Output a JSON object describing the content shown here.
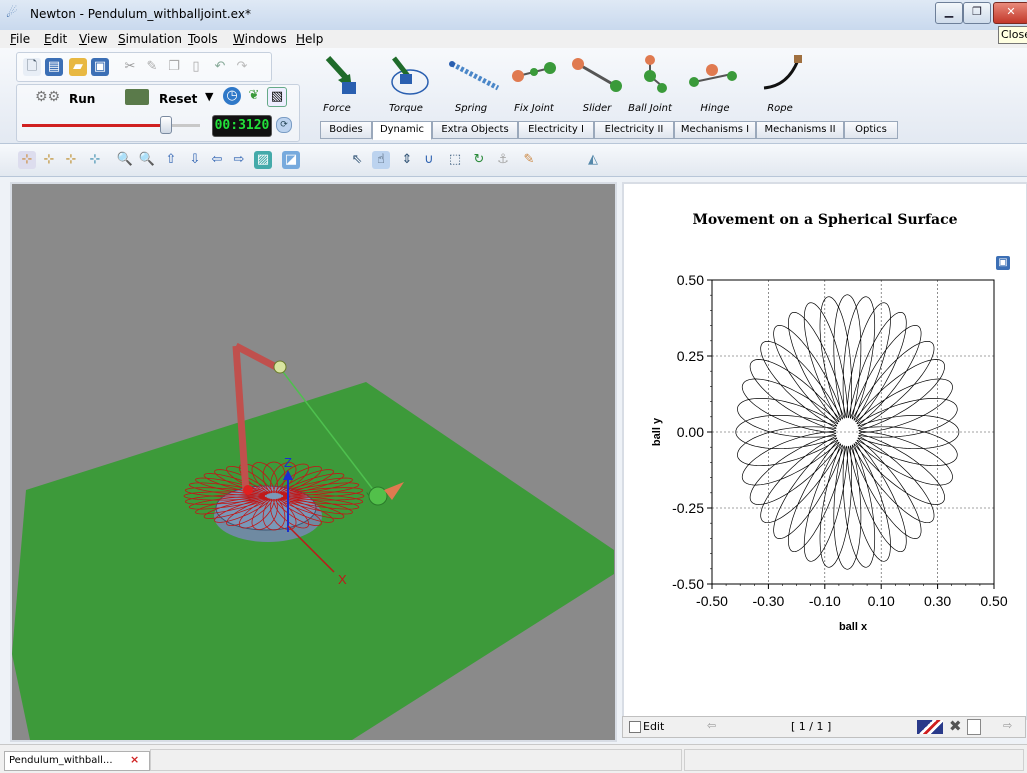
{
  "window": {
    "title": "Newton - Pendulum_withballjoint.ex*",
    "tooltip": "Close",
    "min_glyph": "▁",
    "max_glyph": "❐",
    "close_glyph": "✕"
  },
  "menu": [
    "File",
    "Edit",
    "View",
    "Simulation",
    "Tools",
    "Windows",
    "Help"
  ],
  "sim_controls": {
    "run_label": "Run",
    "reset_label": "Reset",
    "timer": "00:3120",
    "progress": 0.78
  },
  "palette": {
    "items": [
      "Force",
      "Torque",
      "Spring",
      "Fix Joint",
      "Slider",
      "Ball Joint",
      "Hinge",
      "Rope"
    ],
    "tabs": [
      "Bodies",
      "Dynamic",
      "Extra Objects",
      "Electricity I",
      "Electricity II",
      "Mechanisms I",
      "Mechanisms II",
      "Optics"
    ],
    "active_tab": "Dynamic"
  },
  "scene": {
    "axis_z": "Z",
    "axis_x": "X",
    "axis_y": "Y"
  },
  "plot": {
    "title": "Movement on a Spherical Surface",
    "page_indicator": "[ 1 / 1 ]",
    "edit_label": "Edit"
  },
  "chart_data": {
    "type": "line",
    "title": "Movement on a Spherical Surface",
    "xlabel": "ball x",
    "ylabel": "ball y",
    "xlim": [
      -0.5,
      0.5
    ],
    "ylim": [
      -0.5,
      0.5
    ],
    "xticks": [
      "-0.50",
      "-0.30",
      "-0.10",
      "0.10",
      "0.30",
      "0.50"
    ],
    "yticks": [
      "0.50",
      "0.25",
      "0.00",
      "-0.25",
      "-0.50"
    ],
    "grid": true,
    "curve": {
      "outer_radius": 0.43,
      "inner_radius": 0.045,
      "center": [
        -0.02,
        0.0
      ],
      "lobes": 36
    }
  },
  "statusbar": {
    "doc_tab": "Pendulum_withball...",
    "close_glyph": "×"
  },
  "colors": {
    "ground": "#3d9a3a",
    "background": "#8a8a8a",
    "trajectory": "#c01818",
    "rope": "#4ec04e",
    "pole": "#c0504d"
  }
}
